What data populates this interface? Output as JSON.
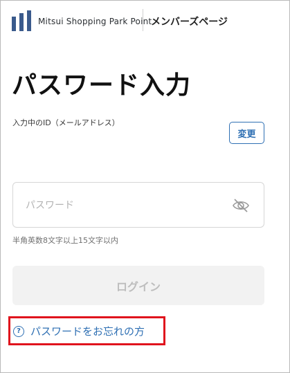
{
  "header": {
    "brand": "Mitsui Shopping Park Point",
    "section": "メンバーズページ"
  },
  "main": {
    "title": "パスワード入力",
    "id_label": "入力中のID（メールアドレス）",
    "change_label": "変更",
    "password": {
      "placeholder": "パスワード",
      "value": "",
      "hint": "半角英数8文字以上15文字以内"
    },
    "login_label": "ログイン",
    "forgot_label": "パスワードをお忘れの方",
    "help_icon_glyph": "?"
  },
  "colors": {
    "accent": "#2e6fb3",
    "highlight": "#e0141d",
    "disabled_bg": "#f2f2f2"
  }
}
